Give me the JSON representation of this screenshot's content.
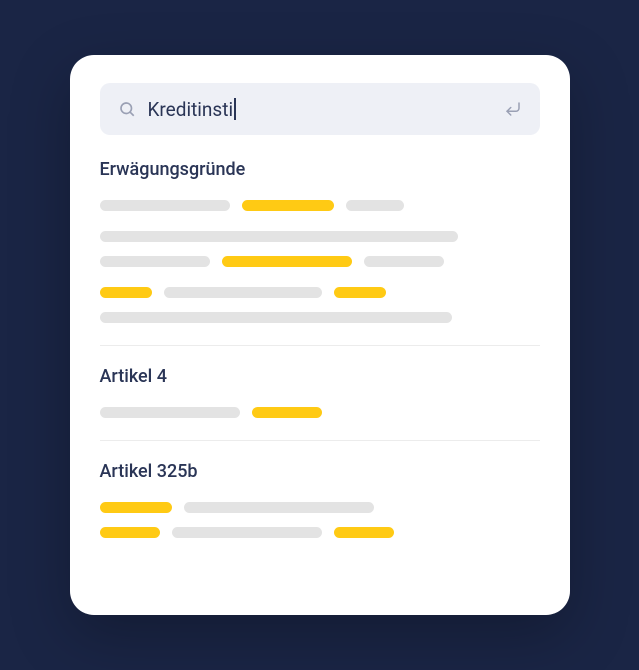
{
  "search": {
    "value": "Kreditinsti",
    "placeholder": ""
  },
  "sections": [
    {
      "title": "Erwägungsgründe"
    },
    {
      "title": "Artikel 4"
    },
    {
      "title": "Artikel 325b"
    }
  ],
  "colors": {
    "highlight": "#ffca14",
    "placeholder": "#e3e3e3",
    "text": "#2a3556",
    "searchBg": "#eef0f6"
  }
}
